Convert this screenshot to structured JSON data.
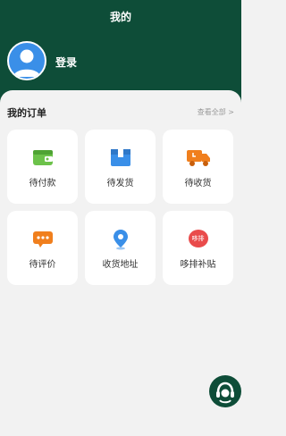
{
  "header": {
    "title": "我的",
    "login_label": "登录",
    "bg_color": "#0e4d38"
  },
  "orders": {
    "title": "我的订单",
    "view_all": "查看全部 >",
    "items": [
      {
        "label": "待付款",
        "icon": "wallet-icon",
        "color": "#6cc24a"
      },
      {
        "label": "待发货",
        "icon": "box-icon",
        "color": "#3a8fe8"
      },
      {
        "label": "待收货",
        "icon": "truck-icon",
        "color": "#f07f1d"
      },
      {
        "label": "待评价",
        "icon": "comment-icon",
        "color": "#f07f1d"
      },
      {
        "label": "收货地址",
        "icon": "location-icon",
        "color": "#3a8fe8"
      },
      {
        "label": "哆排补贴",
        "icon": "subsidy-icon",
        "color": "#e94b4b",
        "badge_text": "哆排"
      }
    ]
  },
  "fab": {
    "icon": "customer-service-icon"
  }
}
